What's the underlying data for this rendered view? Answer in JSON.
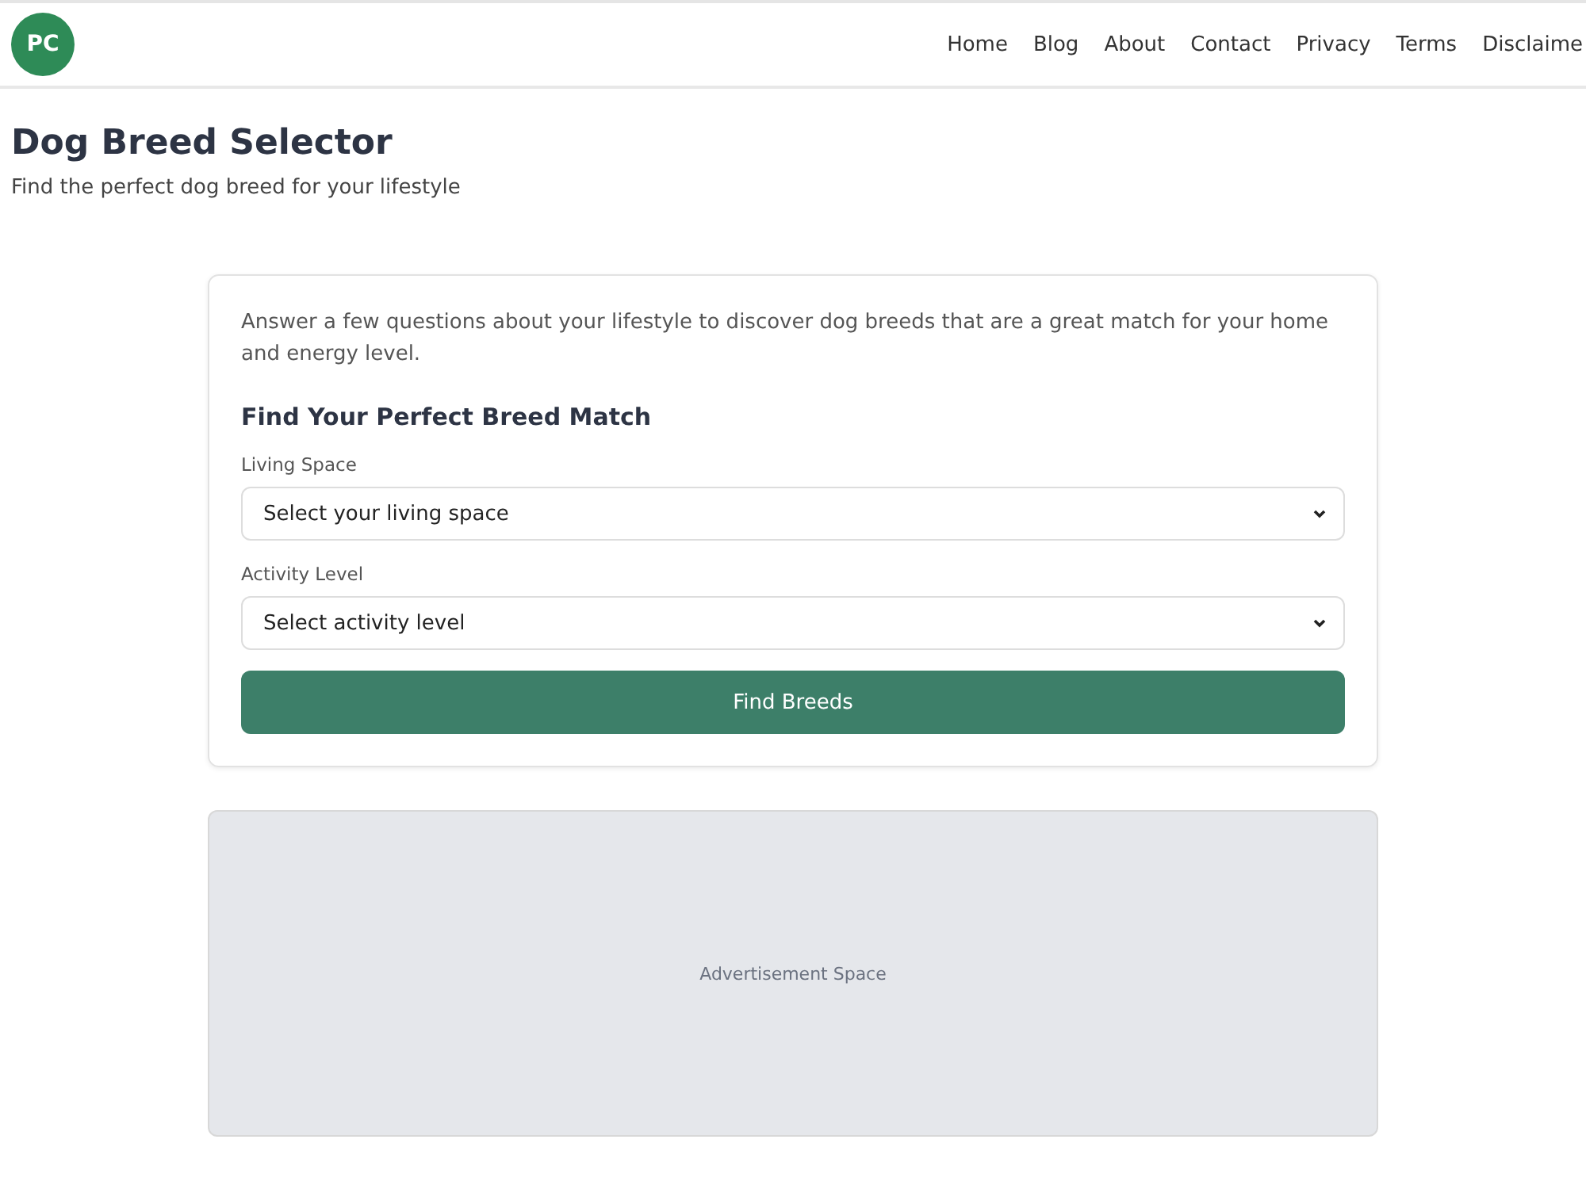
{
  "logo": {
    "text": "PC"
  },
  "nav": [
    "Home",
    "Blog",
    "About",
    "Contact",
    "Privacy",
    "Terms",
    "Disclaime"
  ],
  "page": {
    "title": "Dog Breed Selector",
    "subtitle": "Find the perfect dog breed for your lifestyle"
  },
  "form": {
    "intro": "Answer a few questions about your lifestyle to discover dog breeds that are a great match for your home and energy level.",
    "heading": "Find Your Perfect Breed Match",
    "fields": [
      {
        "label": "Living Space",
        "placeholder": "Select your living space"
      },
      {
        "label": "Activity Level",
        "placeholder": "Select activity level"
      }
    ],
    "button": "Find Breeds"
  },
  "ad": {
    "text": "Advertisement Space"
  }
}
